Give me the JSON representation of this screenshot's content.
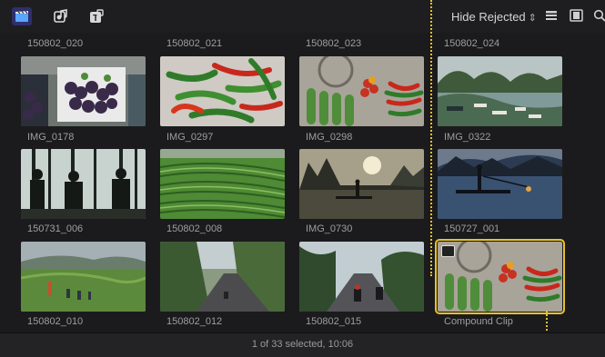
{
  "toolbar": {
    "filter_label": "Hide Rejected",
    "filter_chevron": "⌃⌄",
    "icons": [
      "clapperboard-icon",
      "photo-music-icon",
      "titles-icon",
      "list-view-icon",
      "filmstrip-icon",
      "search-icon"
    ]
  },
  "top_row_labels": [
    "150802_020",
    "150802_021",
    "150802_023",
    "150802_024"
  ],
  "clips": [
    {
      "label": "IMG_0178"
    },
    {
      "label": "IMG_0297"
    },
    {
      "label": "IMG_0298"
    },
    {
      "label": "IMG_0322"
    },
    {
      "label": "150731_006"
    },
    {
      "label": "150802_008"
    },
    {
      "label": "IMG_0730"
    },
    {
      "label": "150727_001"
    },
    {
      "label": "150802_010"
    },
    {
      "label": "150802_012"
    },
    {
      "label": "150802_015"
    },
    {
      "label": "Compound Clip"
    }
  ],
  "status": {
    "text": "1 of 33 selected, 10:06"
  },
  "colors": {
    "selection": "#e8c12a",
    "active_icon_bg": "#2e2f6e"
  }
}
